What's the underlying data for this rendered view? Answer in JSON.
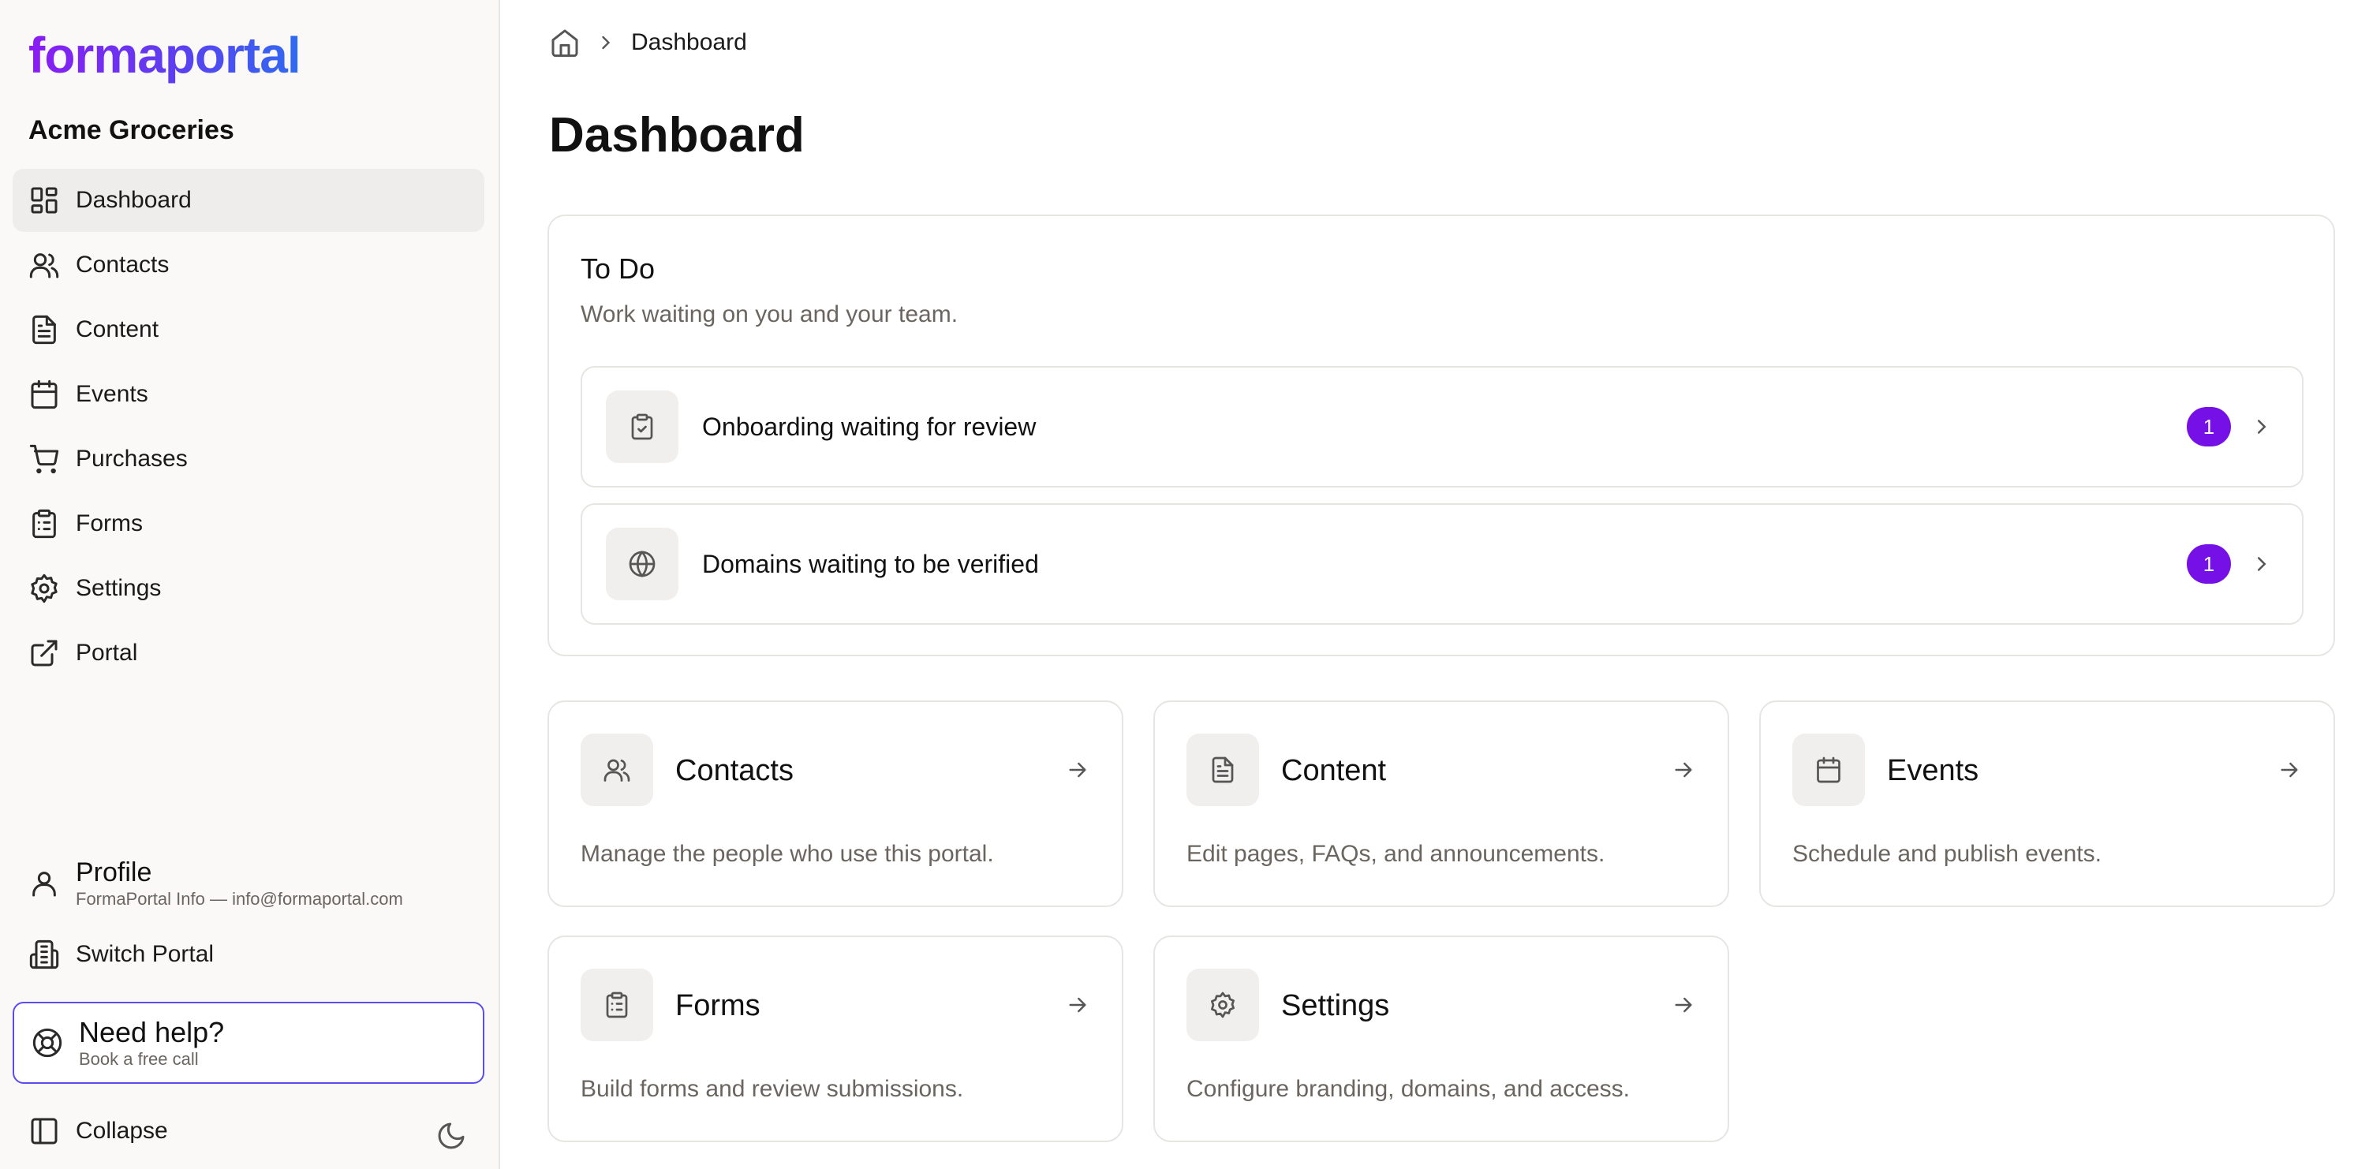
{
  "sidebar": {
    "logo": "formaportal",
    "org_name": "Acme Groceries",
    "nav": [
      {
        "label": "Dashboard",
        "icon": "dashboard-icon",
        "active": true
      },
      {
        "label": "Contacts",
        "icon": "users-icon"
      },
      {
        "label": "Content",
        "icon": "document-icon"
      },
      {
        "label": "Events",
        "icon": "calendar-icon"
      },
      {
        "label": "Purchases",
        "icon": "cart-icon"
      },
      {
        "label": "Forms",
        "icon": "clipboard-icon"
      },
      {
        "label": "Settings",
        "icon": "gear-icon"
      },
      {
        "label": "Portal",
        "icon": "external-link-icon"
      }
    ],
    "profile": {
      "title": "Profile",
      "subtitle": "FormaPortal Info — info@formaportal.com"
    },
    "switch_portal": "Switch Portal",
    "help": {
      "title": "Need help?",
      "subtitle": "Book a free call"
    },
    "collapse": "Collapse"
  },
  "breadcrumb": {
    "current": "Dashboard"
  },
  "page_title": "Dashboard",
  "todo": {
    "title": "To Do",
    "subtitle": "Work waiting on you and your team.",
    "items": [
      {
        "label": "Onboarding waiting for review",
        "count": "1",
        "icon": "clipboard-check-icon"
      },
      {
        "label": "Domains waiting to be verified",
        "count": "1",
        "icon": "globe-icon"
      }
    ]
  },
  "cards": [
    {
      "title": "Contacts",
      "desc": "Manage the people who use this portal.",
      "icon": "users-icon"
    },
    {
      "title": "Content",
      "desc": "Edit pages, FAQs, and announcements.",
      "icon": "document-icon"
    },
    {
      "title": "Events",
      "desc": "Schedule and publish events.",
      "icon": "calendar-icon"
    },
    {
      "title": "Forms",
      "desc": "Build forms and review submissions.",
      "icon": "clipboard-icon"
    },
    {
      "title": "Settings",
      "desc": "Configure branding, domains, and access.",
      "icon": "gear-icon"
    }
  ],
  "colors": {
    "accent": "#7510e6",
    "help_border": "#5b4cf0",
    "sidebar_bg": "#faf9f8"
  }
}
